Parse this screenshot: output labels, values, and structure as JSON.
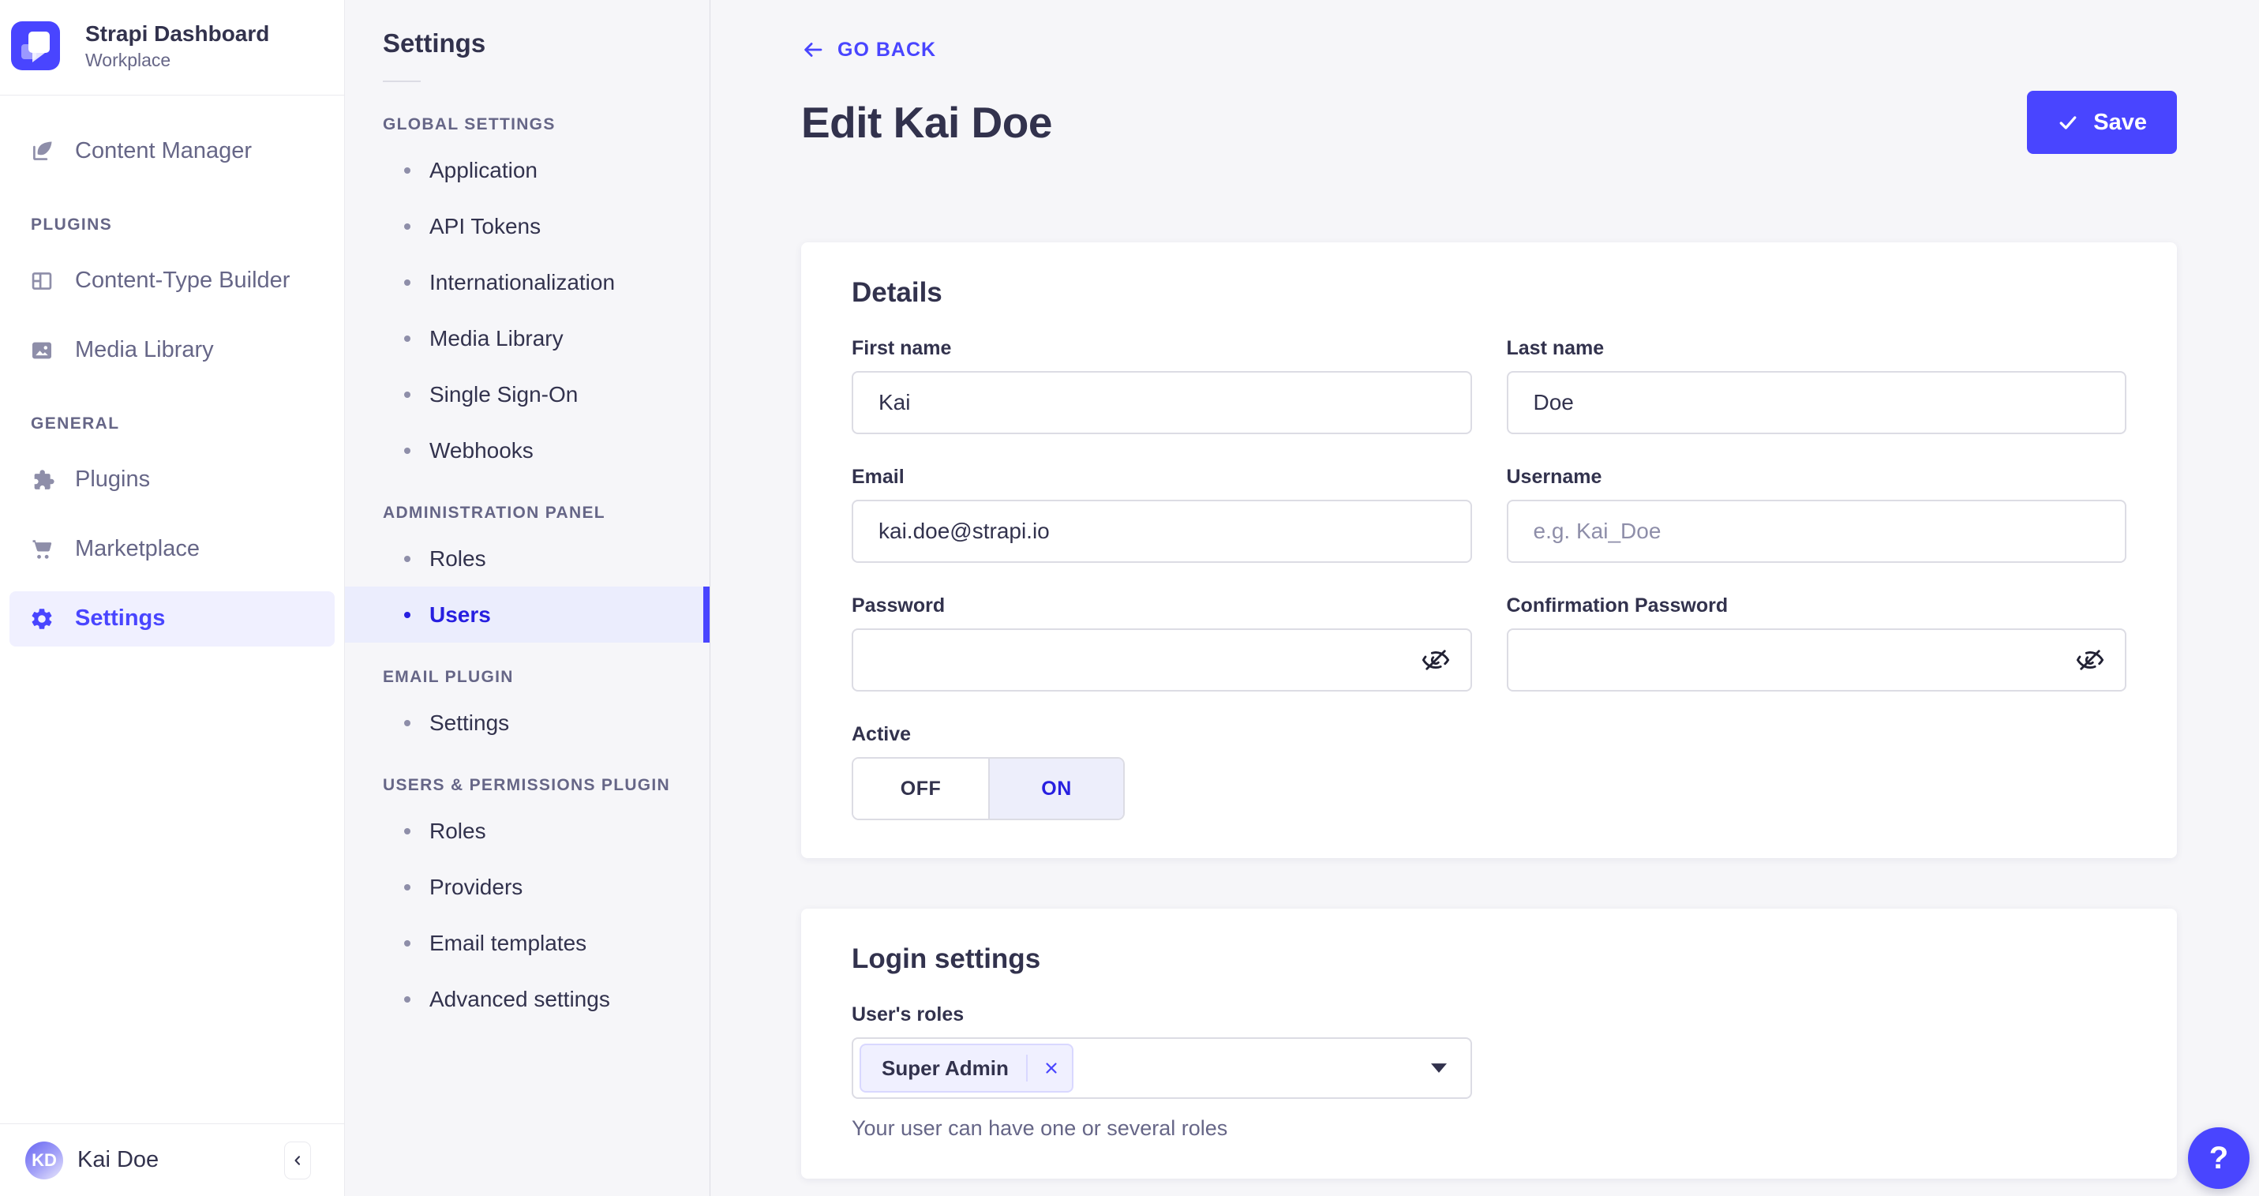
{
  "app": {
    "name": "Strapi Dashboard",
    "workspace": "Workplace"
  },
  "sidebar": {
    "top_items": [
      {
        "label": "Content Manager"
      }
    ],
    "sections": [
      {
        "title": "PLUGINS",
        "items": [
          {
            "label": "Content-Type Builder"
          },
          {
            "label": "Media Library"
          }
        ]
      },
      {
        "title": "GENERAL",
        "items": [
          {
            "label": "Plugins"
          },
          {
            "label": "Marketplace"
          },
          {
            "label": "Settings",
            "active": true
          }
        ]
      }
    ],
    "user": {
      "name": "Kai Doe",
      "initials": "KD"
    }
  },
  "subnav": {
    "title": "Settings",
    "sections": [
      {
        "title": "GLOBAL SETTINGS",
        "items": [
          {
            "label": "Application"
          },
          {
            "label": "API Tokens"
          },
          {
            "label": "Internationalization"
          },
          {
            "label": "Media Library"
          },
          {
            "label": "Single Sign-On"
          },
          {
            "label": "Webhooks"
          }
        ]
      },
      {
        "title": "ADMINISTRATION PANEL",
        "items": [
          {
            "label": "Roles"
          },
          {
            "label": "Users",
            "active": true
          }
        ]
      },
      {
        "title": "EMAIL PLUGIN",
        "items": [
          {
            "label": "Settings"
          }
        ]
      },
      {
        "title": "USERS & PERMISSIONS PLUGIN",
        "items": [
          {
            "label": "Roles"
          },
          {
            "label": "Providers"
          },
          {
            "label": "Email templates"
          },
          {
            "label": "Advanced settings"
          }
        ]
      }
    ]
  },
  "page": {
    "back_label": "GO BACK",
    "title": "Edit Kai Doe",
    "save_label": "Save"
  },
  "details": {
    "heading": "Details",
    "first_name": {
      "label": "First name",
      "value": "Kai"
    },
    "last_name": {
      "label": "Last name",
      "value": "Doe"
    },
    "email": {
      "label": "Email",
      "value": "kai.doe@strapi.io"
    },
    "username": {
      "label": "Username",
      "placeholder": "e.g. Kai_Doe"
    },
    "password": {
      "label": "Password"
    },
    "confirmation_password": {
      "label": "Confirmation Password"
    },
    "active": {
      "label": "Active",
      "off": "OFF",
      "on": "ON",
      "selected": "ON"
    }
  },
  "login": {
    "heading": "Login settings",
    "roles_label": "User's roles",
    "selected_roles": [
      {
        "name": "Super Admin"
      }
    ],
    "helper": "Your user can have one or several roles"
  },
  "help": {
    "label": "?"
  },
  "colors": {
    "primary": "#4945ff",
    "active_text": "#271fe0",
    "primary_light": "#f0f0ff",
    "border": "#dcdce4"
  }
}
